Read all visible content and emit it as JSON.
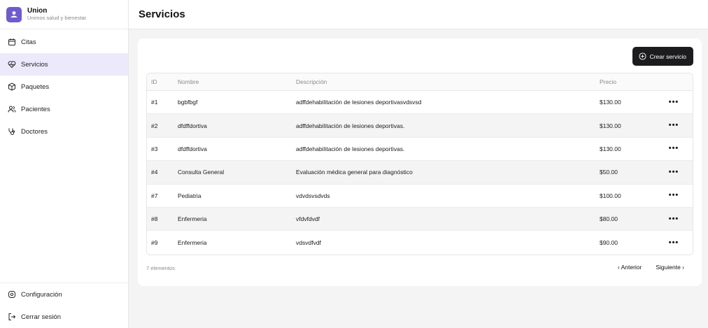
{
  "brand": {
    "name": "Union",
    "tagline": "Unimos salud y bienestar."
  },
  "sidebar": {
    "items": [
      {
        "label": "Citas",
        "icon": "calendar-icon"
      },
      {
        "label": "Servicios",
        "icon": "heart-pulse-icon",
        "active": true
      },
      {
        "label": "Paquetes",
        "icon": "package-icon"
      },
      {
        "label": "Pacientes",
        "icon": "users-icon"
      },
      {
        "label": "Doctores",
        "icon": "stethoscope-icon"
      }
    ],
    "bottom": [
      {
        "label": "Configuración",
        "icon": "settings-icon"
      },
      {
        "label": "Cerrar sesión",
        "icon": "logout-icon"
      }
    ]
  },
  "header": {
    "title": "Servicios"
  },
  "toolbar": {
    "create_label": "Crear servicio"
  },
  "table": {
    "columns": [
      "ID",
      "Nombre",
      "Descripción",
      "Precio"
    ],
    "rows": [
      {
        "id": "#1",
        "name": "bgbfbgf",
        "description": "adffdehabilitación de lesiones deportivasvdsvsd",
        "price": "$130.00"
      },
      {
        "id": "#2",
        "name": "dfdffdortiva",
        "description": "adffdehabilitación de lesiones deportivas.",
        "price": "$130.00"
      },
      {
        "id": "#3",
        "name": "dfdffdortiva",
        "description": "adffdehabilitación de lesiones deportivas.",
        "price": "$130.00"
      },
      {
        "id": "#4",
        "name": "Consulta General",
        "description": "Evaluación médica general para diagnóstico",
        "price": "$50.00"
      },
      {
        "id": "#7",
        "name": "Pediatria",
        "description": "vdvdsvsdvds",
        "price": "$100.00"
      },
      {
        "id": "#8",
        "name": "Enfermeria",
        "description": "vfdvfdvdf",
        "price": "$80.00"
      },
      {
        "id": "#9",
        "name": "Enfermeria",
        "description": "vdsvdfvdf",
        "price": "$90.00"
      }
    ],
    "row_action": "•••"
  },
  "footer": {
    "count_label": "7 elementos",
    "prev_label": "‹ Anterior",
    "next_label": "Siguiente ›"
  },
  "colors": {
    "accent": "#6d5bd0",
    "active_bg": "#ece9fb",
    "button_bg": "#1c1c1e"
  }
}
